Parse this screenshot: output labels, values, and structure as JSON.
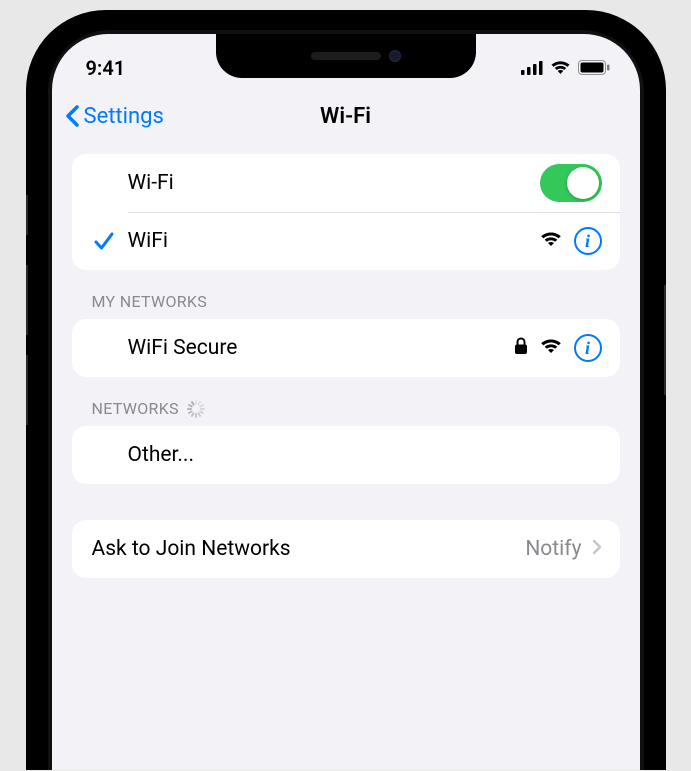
{
  "status": {
    "time": "9:41"
  },
  "nav": {
    "back_label": "Settings",
    "title": "Wi-Fi"
  },
  "wifi_toggle": {
    "label": "Wi-Fi",
    "on": true
  },
  "connected": {
    "name": "WiFi",
    "checked": true,
    "secure": false
  },
  "sections": {
    "my_networks": "MY NETWORKS",
    "networks": "NETWORKS"
  },
  "my_networks": [
    {
      "name": "WiFi Secure",
      "secure": true
    }
  ],
  "other_label": "Other...",
  "ask_join": {
    "label": "Ask to Join Networks",
    "value": "Notify"
  },
  "icons": {
    "info": "i"
  }
}
